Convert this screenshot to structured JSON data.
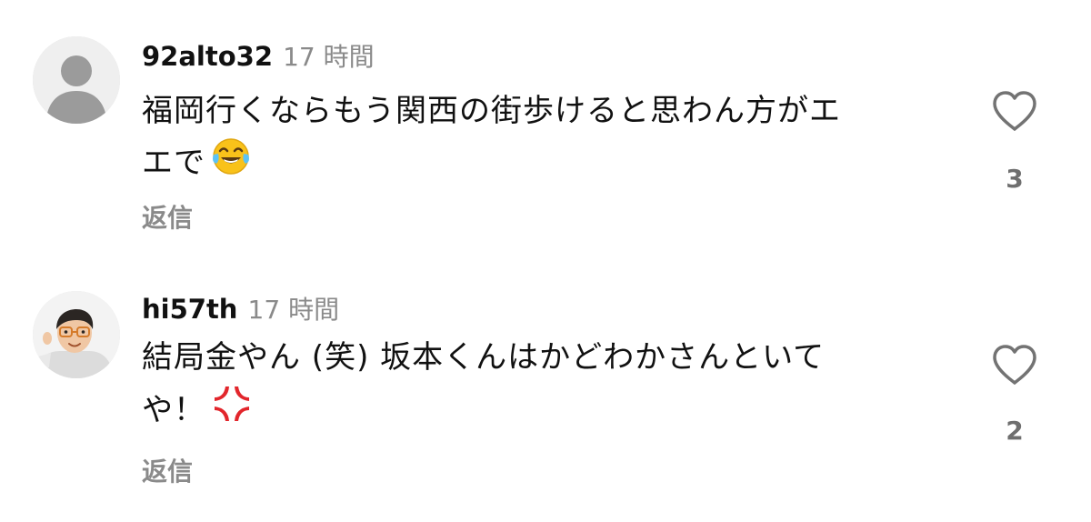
{
  "comments": [
    {
      "username": "92alto32",
      "time": "17 時間",
      "lines": [
        "福岡行くならもう関西の街歩けると思わん方がエ",
        "エで"
      ],
      "emoji": "face-with-tears-of-joy",
      "reply_label": "返信",
      "like_count": "3",
      "avatar": "default-avatar"
    },
    {
      "username": "hi57th",
      "time": "17 時間",
      "lines": [
        "結局金やん (笑) 坂本くんはかどわかさんといて",
        "や！"
      ],
      "emoji": "anger-symbol",
      "reply_label": "返信",
      "like_count": "2",
      "avatar": "memoji-avatar"
    }
  ],
  "colors": {
    "text": "#111111",
    "muted": "#8a8a8a",
    "icon": "#737373",
    "anger": "#e2262c",
    "joy": "#f9c21a"
  }
}
